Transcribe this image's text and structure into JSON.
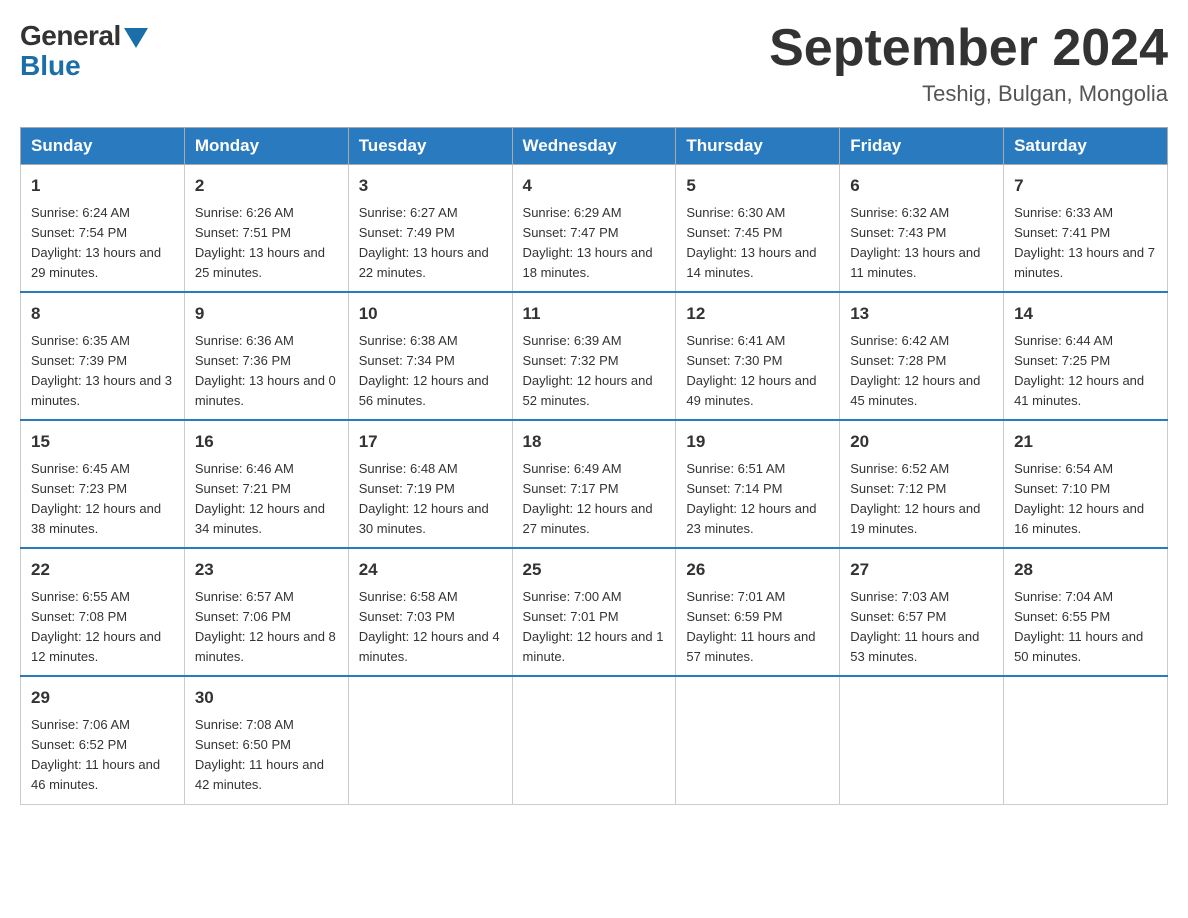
{
  "header": {
    "logo_general": "General",
    "logo_blue": "Blue",
    "month_title": "September 2024",
    "location": "Teshig, Bulgan, Mongolia"
  },
  "weekdays": [
    "Sunday",
    "Monday",
    "Tuesday",
    "Wednesday",
    "Thursday",
    "Friday",
    "Saturday"
  ],
  "weeks": [
    [
      {
        "day": "1",
        "sunrise": "6:24 AM",
        "sunset": "7:54 PM",
        "daylight": "13 hours and 29 minutes."
      },
      {
        "day": "2",
        "sunrise": "6:26 AM",
        "sunset": "7:51 PM",
        "daylight": "13 hours and 25 minutes."
      },
      {
        "day": "3",
        "sunrise": "6:27 AM",
        "sunset": "7:49 PM",
        "daylight": "13 hours and 22 minutes."
      },
      {
        "day": "4",
        "sunrise": "6:29 AM",
        "sunset": "7:47 PM",
        "daylight": "13 hours and 18 minutes."
      },
      {
        "day": "5",
        "sunrise": "6:30 AM",
        "sunset": "7:45 PM",
        "daylight": "13 hours and 14 minutes."
      },
      {
        "day": "6",
        "sunrise": "6:32 AM",
        "sunset": "7:43 PM",
        "daylight": "13 hours and 11 minutes."
      },
      {
        "day": "7",
        "sunrise": "6:33 AM",
        "sunset": "7:41 PM",
        "daylight": "13 hours and 7 minutes."
      }
    ],
    [
      {
        "day": "8",
        "sunrise": "6:35 AM",
        "sunset": "7:39 PM",
        "daylight": "13 hours and 3 minutes."
      },
      {
        "day": "9",
        "sunrise": "6:36 AM",
        "sunset": "7:36 PM",
        "daylight": "13 hours and 0 minutes."
      },
      {
        "day": "10",
        "sunrise": "6:38 AM",
        "sunset": "7:34 PM",
        "daylight": "12 hours and 56 minutes."
      },
      {
        "day": "11",
        "sunrise": "6:39 AM",
        "sunset": "7:32 PM",
        "daylight": "12 hours and 52 minutes."
      },
      {
        "day": "12",
        "sunrise": "6:41 AM",
        "sunset": "7:30 PM",
        "daylight": "12 hours and 49 minutes."
      },
      {
        "day": "13",
        "sunrise": "6:42 AM",
        "sunset": "7:28 PM",
        "daylight": "12 hours and 45 minutes."
      },
      {
        "day": "14",
        "sunrise": "6:44 AM",
        "sunset": "7:25 PM",
        "daylight": "12 hours and 41 minutes."
      }
    ],
    [
      {
        "day": "15",
        "sunrise": "6:45 AM",
        "sunset": "7:23 PM",
        "daylight": "12 hours and 38 minutes."
      },
      {
        "day": "16",
        "sunrise": "6:46 AM",
        "sunset": "7:21 PM",
        "daylight": "12 hours and 34 minutes."
      },
      {
        "day": "17",
        "sunrise": "6:48 AM",
        "sunset": "7:19 PM",
        "daylight": "12 hours and 30 minutes."
      },
      {
        "day": "18",
        "sunrise": "6:49 AM",
        "sunset": "7:17 PM",
        "daylight": "12 hours and 27 minutes."
      },
      {
        "day": "19",
        "sunrise": "6:51 AM",
        "sunset": "7:14 PM",
        "daylight": "12 hours and 23 minutes."
      },
      {
        "day": "20",
        "sunrise": "6:52 AM",
        "sunset": "7:12 PM",
        "daylight": "12 hours and 19 minutes."
      },
      {
        "day": "21",
        "sunrise": "6:54 AM",
        "sunset": "7:10 PM",
        "daylight": "12 hours and 16 minutes."
      }
    ],
    [
      {
        "day": "22",
        "sunrise": "6:55 AM",
        "sunset": "7:08 PM",
        "daylight": "12 hours and 12 minutes."
      },
      {
        "day": "23",
        "sunrise": "6:57 AM",
        "sunset": "7:06 PM",
        "daylight": "12 hours and 8 minutes."
      },
      {
        "day": "24",
        "sunrise": "6:58 AM",
        "sunset": "7:03 PM",
        "daylight": "12 hours and 4 minutes."
      },
      {
        "day": "25",
        "sunrise": "7:00 AM",
        "sunset": "7:01 PM",
        "daylight": "12 hours and 1 minute."
      },
      {
        "day": "26",
        "sunrise": "7:01 AM",
        "sunset": "6:59 PM",
        "daylight": "11 hours and 57 minutes."
      },
      {
        "day": "27",
        "sunrise": "7:03 AM",
        "sunset": "6:57 PM",
        "daylight": "11 hours and 53 minutes."
      },
      {
        "day": "28",
        "sunrise": "7:04 AM",
        "sunset": "6:55 PM",
        "daylight": "11 hours and 50 minutes."
      }
    ],
    [
      {
        "day": "29",
        "sunrise": "7:06 AM",
        "sunset": "6:52 PM",
        "daylight": "11 hours and 46 minutes."
      },
      {
        "day": "30",
        "sunrise": "7:08 AM",
        "sunset": "6:50 PM",
        "daylight": "11 hours and 42 minutes."
      },
      null,
      null,
      null,
      null,
      null
    ]
  ]
}
